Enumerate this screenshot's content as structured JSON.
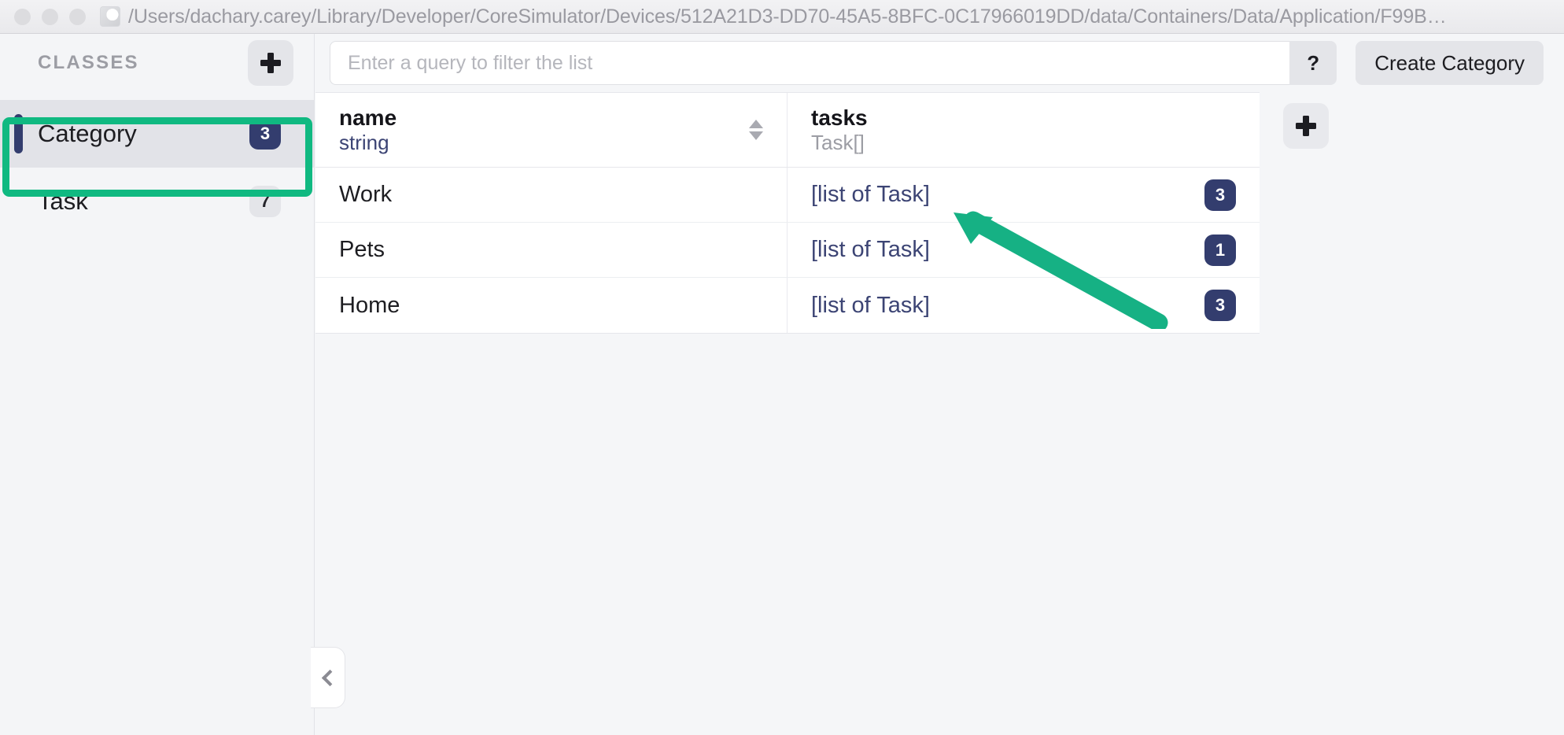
{
  "window": {
    "title_path": "/Users/dachary.carey/Library/Developer/CoreSimulator/Devices/512A21D3-DD70-45A5-8BFC-0C17966019DD/data/Containers/Data/Application/F99B…",
    "favicon": "app-icon",
    "traffic_lights": [
      "close-button",
      "minimize-button",
      "zoom-button"
    ]
  },
  "sidebar": {
    "header_label": "CLASSES",
    "add_class_icon": "plus-icon",
    "collapse_icon": "chevron-left-icon",
    "items": [
      {
        "label": "Category",
        "count": "3",
        "selected": true
      },
      {
        "label": "Task",
        "count": "7",
        "selected": false
      }
    ]
  },
  "toolbar": {
    "query_value": "",
    "query_placeholder": "Enter a query to filter the list",
    "help_label": "?",
    "create_label": "Create Category"
  },
  "table": {
    "add_property_icon": "plus-icon",
    "columns": [
      {
        "name": "name",
        "type": "string",
        "sortable": true,
        "sort_icon": "sort-updown-icon"
      },
      {
        "name": "tasks",
        "type": "Task[]",
        "sortable": false,
        "sort_icon": ""
      }
    ],
    "rows": [
      {
        "name": "Work",
        "tasks_label": "[list of Task]",
        "tasks_count": "3"
      },
      {
        "name": "Pets",
        "tasks_label": "[list of Task]",
        "tasks_count": "1"
      },
      {
        "name": "Home",
        "tasks_label": "[list of Task]",
        "tasks_count": "3"
      }
    ]
  },
  "annotations": {
    "highlight_color": "#10b981",
    "arrow_color": "#16b184",
    "highlight_target": "sidebar-item-category",
    "arrow_target": "row-work-tasks-link"
  },
  "colors": {
    "accent_navy": "#333d6e",
    "badge_dark_bg": "#333d6e",
    "badge_light_bg": "#e4e5e9",
    "link_navy": "#3c4474",
    "annotation_green": "#10b981"
  }
}
